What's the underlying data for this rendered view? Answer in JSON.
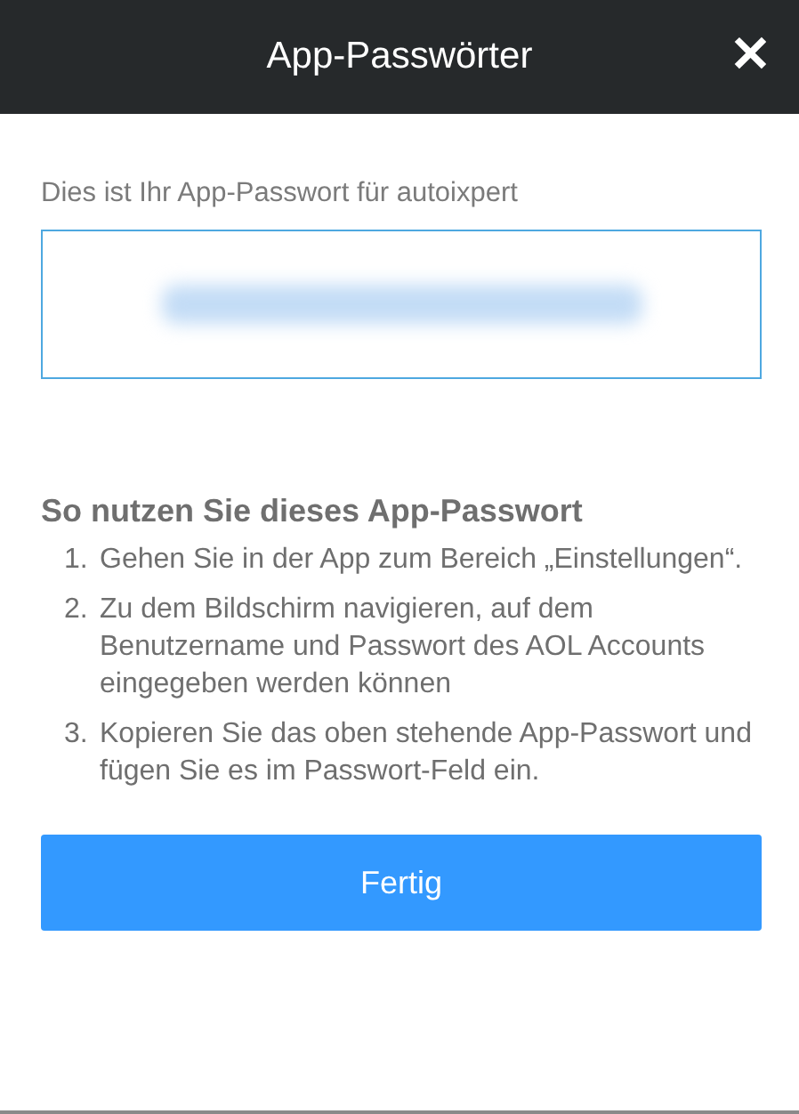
{
  "header": {
    "title": "App-Passwörter",
    "close": "✕"
  },
  "password_label": "Dies ist Ihr App-Passwort für autoixpert",
  "instructions": {
    "heading": "So nutzen Sie dieses App-Passwort",
    "steps": [
      {
        "number": "1.",
        "text": "Gehen Sie in der App zum Bereich „Einstellungen“."
      },
      {
        "number": "2.",
        "text": "Zu dem Bildschirm navigieren, auf dem Benutzername und Passwort des AOL Accounts eingegeben werden können"
      },
      {
        "number": "3.",
        "text": "Kopieren Sie das oben stehende App-Passwort und fügen Sie es im Passwort-Feld ein."
      }
    ]
  },
  "done_button": "Fertig"
}
